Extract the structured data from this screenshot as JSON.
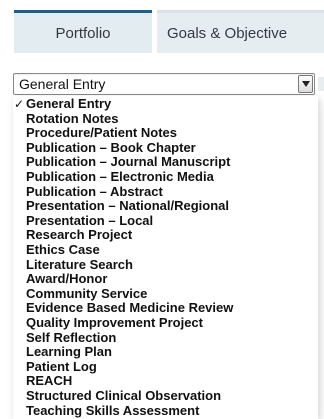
{
  "tabs": [
    {
      "label": "Portfolio",
      "active": true
    },
    {
      "label": "Goals & Objective",
      "active": false
    }
  ],
  "select": {
    "value": "General Entry",
    "button_icon": "chevron-down-icon"
  },
  "dropdown": {
    "check_glyph": "✓",
    "options": [
      {
        "label": "General Entry",
        "selected": true
      },
      {
        "label": "Rotation Notes",
        "selected": false
      },
      {
        "label": "Procedure/Patient Notes",
        "selected": false
      },
      {
        "label": "Publication – Book Chapter",
        "selected": false
      },
      {
        "label": "Publication – Journal Manuscript",
        "selected": false
      },
      {
        "label": "Publication – Electronic Media",
        "selected": false
      },
      {
        "label": "Publication – Abstract",
        "selected": false
      },
      {
        "label": "Presentation – National/Regional",
        "selected": false
      },
      {
        "label": "Presentation – Local",
        "selected": false
      },
      {
        "label": "Research Project",
        "selected": false
      },
      {
        "label": "Ethics Case",
        "selected": false
      },
      {
        "label": "Literature Search",
        "selected": false
      },
      {
        "label": "Award/Honor",
        "selected": false
      },
      {
        "label": "Community Service",
        "selected": false
      },
      {
        "label": "Evidence Based Medicine Review",
        "selected": false
      },
      {
        "label": "Quality Improvement Project",
        "selected": false
      },
      {
        "label": "Self Reflection",
        "selected": false
      },
      {
        "label": "Learning Plan",
        "selected": false
      },
      {
        "label": "Patient Log",
        "selected": false
      },
      {
        "label": "REACH",
        "selected": false
      },
      {
        "label": "Structured Clinical Observation",
        "selected": false
      },
      {
        "label": "Teaching Skills Assessment",
        "selected": false
      }
    ]
  },
  "colors": {
    "tab_active_border": "#1f5f86",
    "tab_background": "#e3ecf1",
    "text": "#111111"
  }
}
